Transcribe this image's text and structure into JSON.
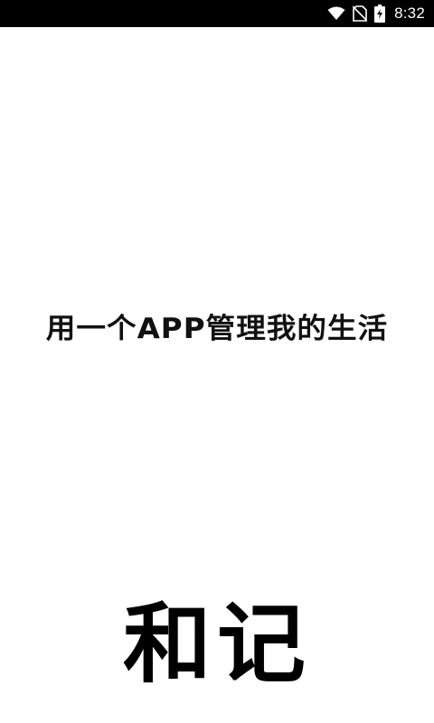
{
  "status_bar": {
    "time": "8:32",
    "icons": [
      "wifi-icon",
      "no-sim-icon",
      "battery-charging-icon"
    ]
  },
  "splash": {
    "tagline": "用一个APP管理我的生活",
    "logo_text": "和记"
  }
}
